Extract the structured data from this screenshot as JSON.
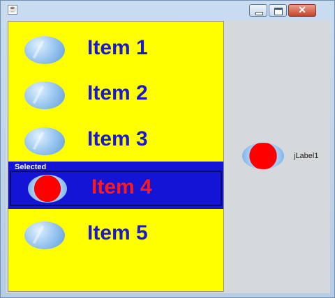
{
  "window": {
    "icon": "java-cup-icon",
    "controls": {
      "close_glyph": "✕"
    }
  },
  "list": {
    "selected_caption": "Selected",
    "items": [
      {
        "label": "Item 1",
        "icon": "blue-ball-icon",
        "selected": false
      },
      {
        "label": "Item 2",
        "icon": "blue-ball-icon",
        "selected": false
      },
      {
        "label": "Item 3",
        "icon": "blue-ball-icon",
        "selected": false
      },
      {
        "label": "Item 4",
        "icon": "red-ball-icon",
        "selected": true
      },
      {
        "label": "Item 5",
        "icon": "blue-ball-icon",
        "selected": false
      }
    ]
  },
  "side": {
    "icon": "red-ball-icon",
    "label": "jLabel1"
  },
  "colors": {
    "list_background": "#ffff00",
    "item_text": "#1a1acc",
    "selection_background": "#1414d6",
    "selected_text": "#ff1a1a",
    "panel_background": "#d5d8dd"
  }
}
